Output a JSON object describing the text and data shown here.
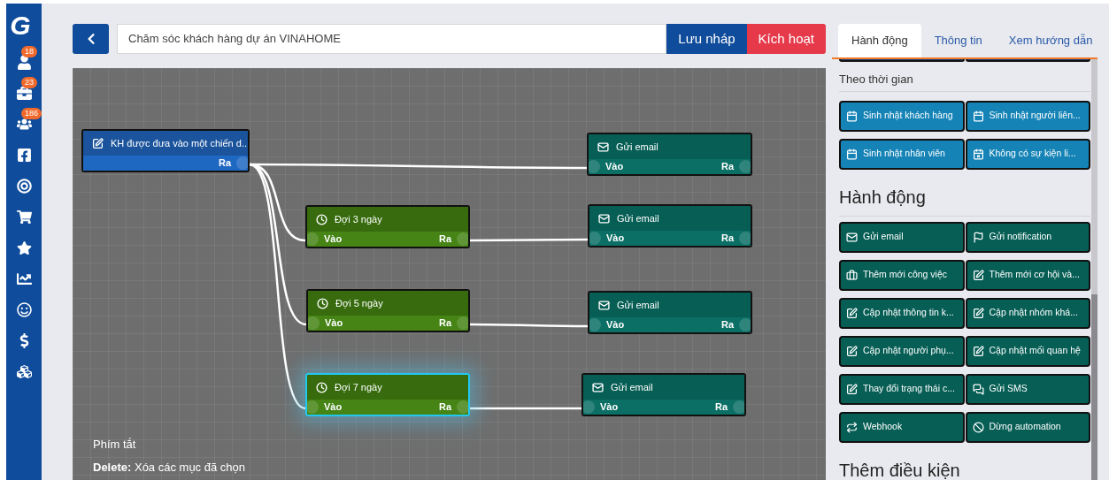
{
  "sidebar": {
    "logo": "G",
    "badges": [
      "18",
      "23",
      "186"
    ]
  },
  "header": {
    "campaign_name": "Chăm sóc khách hàng dự án VINAHOME",
    "save_draft": "Lưu nháp",
    "activate": "Kích hoạt"
  },
  "canvas": {
    "nodes": [
      {
        "kind": "trigger",
        "title": "KH được đưa vào một chiến d...",
        "out_label": "Ra",
        "selected": false
      },
      {
        "kind": "email",
        "title": "Gửi email",
        "in_label": "Vào",
        "out_label": "Ra",
        "selected": false
      },
      {
        "kind": "wait",
        "title": "Đợi 3 ngày",
        "in_label": "Vào",
        "out_label": "Ra",
        "selected": false
      },
      {
        "kind": "email",
        "title": "Gửi email",
        "in_label": "Vào",
        "out_label": "Ra",
        "selected": false
      },
      {
        "kind": "wait",
        "title": "Đợi 5 ngày",
        "in_label": "Vào",
        "out_label": "Ra",
        "selected": false
      },
      {
        "kind": "email",
        "title": "Gửi email",
        "in_label": "Vào",
        "out_label": "Ra",
        "selected": false
      },
      {
        "kind": "wait",
        "title": "Đợi 7 ngày",
        "in_label": "Vào",
        "out_label": "Ra",
        "selected": true
      },
      {
        "kind": "email",
        "title": "Gửi email",
        "in_label": "Vào",
        "out_label": "Ra",
        "selected": false
      }
    ],
    "shortcuts_title": "Phím tắt",
    "shortcut": "**Delete:** Xóa các mục đã chọn"
  },
  "panel": {
    "tabs": [
      {
        "label": "Hành động",
        "selected": true
      },
      {
        "label": "Thông tin",
        "selected": false
      },
      {
        "label": "Xem hướng dẫn",
        "selected": false
      }
    ],
    "sections": [
      {
        "kind": "time",
        "title": "Theo thời gian",
        "buttons": [
          "Sinh nhật khách hàng",
          "Sinh nhật người liên...",
          "Sinh nhật nhân viên",
          "Không có sự kiện li..."
        ]
      },
      {
        "kind": "actions",
        "title": "Hành động",
        "buttons": [
          "Gửi email",
          "Gửi notification",
          "Thêm mới công việc",
          "Thêm mới cơ hội và...",
          "Cập nhật thông tin k...",
          "Cập nhật nhóm khá...",
          "Cập nhật người phụ...",
          "Cập nhật mối quan hệ",
          "Thay đổi trạng thái c...",
          "Gửi SMS",
          "Webhook",
          "Dừng automation"
        ]
      },
      {
        "kind": "conditions",
        "title": "Thêm điều kiện"
      }
    ]
  }
}
